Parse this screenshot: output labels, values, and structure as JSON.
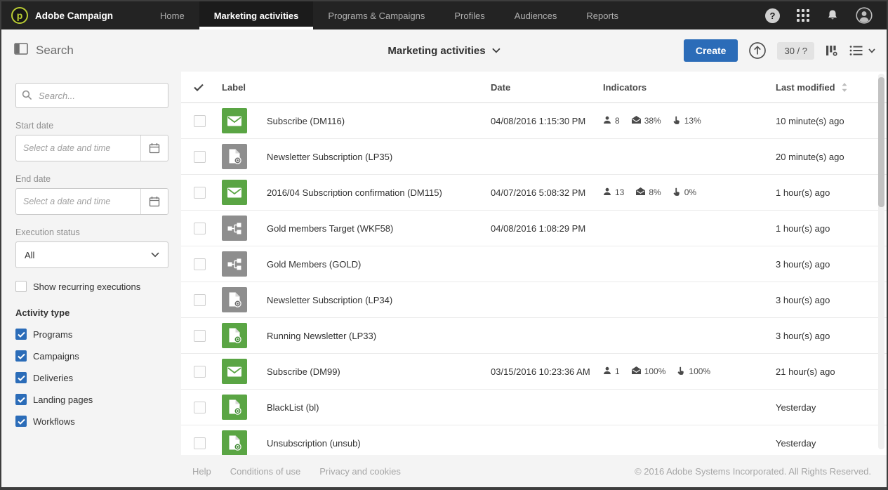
{
  "colors": {
    "accent_blue": "#2b6cb8",
    "icon_green": "#5aa544",
    "icon_green_dark": "#3f8a33",
    "icon_gray": "#8e8e8e",
    "icon_gray_dark": "#6e6e6e",
    "topbar_bg": "#232323"
  },
  "topnav": {
    "brand": "Adobe Campaign",
    "logo_letter": "p",
    "items": [
      {
        "label": "Home",
        "active": false
      },
      {
        "label": "Marketing activities",
        "active": true
      },
      {
        "label": "Programs & Campaigns",
        "active": false
      },
      {
        "label": "Profiles",
        "active": false
      },
      {
        "label": "Audiences",
        "active": false
      },
      {
        "label": "Reports",
        "active": false
      }
    ],
    "icons": [
      "help",
      "apps",
      "notifications",
      "account"
    ]
  },
  "toolbar": {
    "search_label": "Search",
    "context_label": "Marketing activities",
    "create_label": "Create",
    "count_badge": "30 / ?"
  },
  "sidebar": {
    "search_placeholder": "Search...",
    "start_date_label": "Start date",
    "end_date_label": "End date",
    "date_placeholder": "Select a date and time",
    "execution_status_label": "Execution status",
    "execution_status_value": "All",
    "recurring_label": "Show recurring executions",
    "recurring_checked": false,
    "activity_type_label": "Activity type",
    "activity_types": [
      {
        "label": "Programs",
        "checked": true
      },
      {
        "label": "Campaigns",
        "checked": true
      },
      {
        "label": "Deliveries",
        "checked": true
      },
      {
        "label": "Landing pages",
        "checked": true
      },
      {
        "label": "Workflows",
        "checked": true
      }
    ]
  },
  "table": {
    "columns": [
      "Label",
      "Date",
      "Indicators",
      "Last modified"
    ],
    "rows": [
      {
        "icon": "email",
        "color": "green",
        "label": "Subscribe (DM116)",
        "date": "04/08/2016 1:15:30 PM",
        "indicators": [
          {
            "icon": "audience",
            "value": "8"
          },
          {
            "icon": "open-rate",
            "value": "38%"
          },
          {
            "icon": "click-rate",
            "value": "13%"
          }
        ],
        "last_modified": "10 minute(s) ago"
      },
      {
        "icon": "landing-page",
        "color": "gray",
        "label": "Newsletter Subscription (LP35)",
        "date": "",
        "indicators": [],
        "last_modified": "20 minute(s) ago"
      },
      {
        "icon": "email",
        "color": "green",
        "label": "2016/04 Subscription confirmation (DM115)",
        "date": "04/07/2016 5:08:32 PM",
        "indicators": [
          {
            "icon": "audience",
            "value": "13"
          },
          {
            "icon": "open-rate",
            "value": "8%"
          },
          {
            "icon": "click-rate",
            "value": "0%"
          }
        ],
        "last_modified": "1 hour(s) ago"
      },
      {
        "icon": "workflow",
        "color": "gray",
        "label": "Gold members Target (WKF58)",
        "date": "04/08/2016 1:08:29 PM",
        "indicators": [],
        "last_modified": "1 hour(s) ago"
      },
      {
        "icon": "workflow",
        "color": "gray",
        "label": "Gold Members (GOLD)",
        "date": "",
        "indicators": [],
        "last_modified": "3 hour(s) ago"
      },
      {
        "icon": "landing-page",
        "color": "gray",
        "label": "Newsletter Subscription (LP34)",
        "date": "",
        "indicators": [],
        "last_modified": "3 hour(s) ago"
      },
      {
        "icon": "landing-page",
        "color": "green",
        "label": "Running Newsletter (LP33)",
        "date": "",
        "indicators": [],
        "last_modified": "3 hour(s) ago"
      },
      {
        "icon": "email",
        "color": "green",
        "label": "Subscribe (DM99)",
        "date": "03/15/2016 10:23:36 AM",
        "indicators": [
          {
            "icon": "audience",
            "value": "1"
          },
          {
            "icon": "open-rate",
            "value": "100%"
          },
          {
            "icon": "click-rate",
            "value": "100%"
          }
        ],
        "last_modified": "21 hour(s) ago"
      },
      {
        "icon": "landing-page",
        "color": "green",
        "label": "BlackList (bl)",
        "date": "",
        "indicators": [],
        "last_modified": "Yesterday"
      },
      {
        "icon": "landing-page",
        "color": "green",
        "label": "Unsubscription (unsub)",
        "date": "",
        "indicators": [],
        "last_modified": "Yesterday"
      }
    ]
  },
  "footer": {
    "links": [
      "Help",
      "Conditions of use",
      "Privacy and cookies"
    ],
    "copyright": "© 2016 Adobe Systems Incorporated. All Rights Reserved."
  }
}
